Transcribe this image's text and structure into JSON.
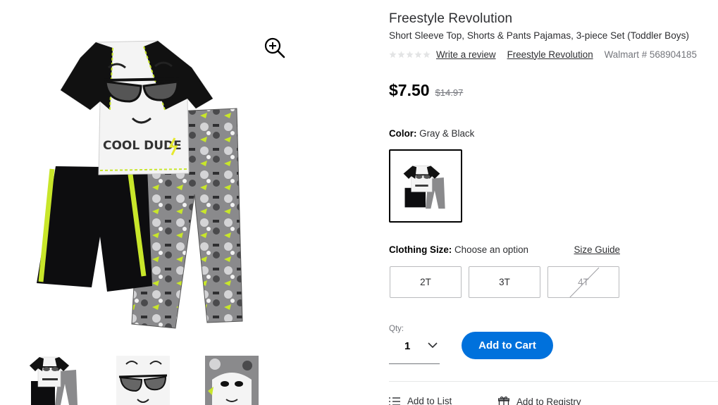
{
  "product": {
    "brand_title": "Freestyle Revolution",
    "name": "Short Sleeve Top, Shorts & Pants Pajamas, 3-piece Set (Toddler Boys)",
    "rating_stars": 5,
    "write_review": "Write a review",
    "brand_link": "Freestyle Revolution",
    "item_number": "Walmart # 568904185",
    "shirt_print": "COOL DUDE"
  },
  "price": {
    "current": "$7.50",
    "was": "$14.97"
  },
  "color": {
    "label": "Color:",
    "value": "Gray & Black"
  },
  "size": {
    "label": "Clothing Size:",
    "value": "Choose an option",
    "guide": "Size Guide",
    "options": [
      "2T",
      "3T",
      "4T"
    ]
  },
  "quantity": {
    "label": "Qty:",
    "value": "1"
  },
  "actions": {
    "add_to_cart": "Add to Cart",
    "add_to_list": "Add to List",
    "add_to_registry": "Add to Registry"
  },
  "icons": {
    "zoom": "zoom-in-icon",
    "chevron": "chevron-down-icon",
    "list": "list-icon",
    "gift": "gift-icon",
    "star": "star-icon"
  },
  "colors": {
    "accent": "#0071dc",
    "text": "#2e2f32",
    "muted": "#74767c",
    "neon": "#c8e62a"
  }
}
